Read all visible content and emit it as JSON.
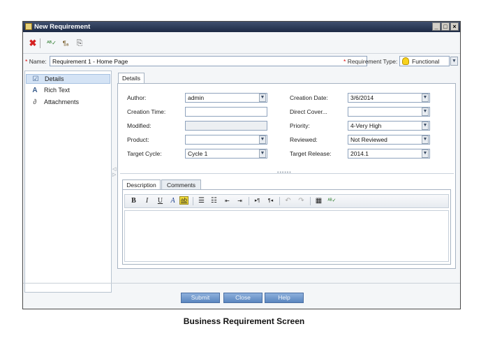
{
  "window": {
    "title": "New Requirement"
  },
  "toolbar": {
    "icons": [
      "delete-icon",
      "spell-check-icon",
      "thesaurus-icon",
      "clipboard-icon"
    ]
  },
  "name_field": {
    "label": "Name:",
    "value": "Requirement 1 - Home Page"
  },
  "req_type": {
    "label": "Requirement Type:",
    "value": "Functional"
  },
  "sidebar": {
    "items": [
      {
        "label": "Details",
        "icon": "details-icon"
      },
      {
        "label": "Rich Text",
        "icon": "rich-text-icon"
      },
      {
        "label": "Attachments",
        "icon": "paperclip-icon"
      }
    ]
  },
  "details_tab": "Details",
  "fields": {
    "author": {
      "label": "Author:",
      "value": "admin"
    },
    "creation_time": {
      "label": "Creation Time:",
      "value": ""
    },
    "modified": {
      "label": "Modified:",
      "value": ""
    },
    "product": {
      "label": "Product:",
      "value": ""
    },
    "target_cycle": {
      "label": "Target Cycle:",
      "value": "Cycle 1"
    },
    "creation_date": {
      "label": "Creation Date:",
      "value": "3/6/2014"
    },
    "direct_cover": {
      "label": "Direct  Cover...",
      "value": ""
    },
    "priority": {
      "label": "Priority:",
      "value": "4-Very High"
    },
    "reviewed": {
      "label": "Reviewed:",
      "value": "Not Reviewed"
    },
    "target_release": {
      "label": "Target Release:",
      "value": "2014.1"
    }
  },
  "subtabs": {
    "description": "Description",
    "comments": "Comments"
  },
  "editor": {
    "bold": "B",
    "italic": "I",
    "underline": "U",
    "font_color": "A",
    "highlight": "ab"
  },
  "buttons": {
    "submit": "Submit",
    "close": "Close",
    "help": "Help"
  },
  "caption": "Business Requirement Screen",
  "colors": {
    "titlebar": "#1d2a45",
    "button": "#5b86bf",
    "required": "#dd0000",
    "active_nav": "#d4e3f5"
  }
}
